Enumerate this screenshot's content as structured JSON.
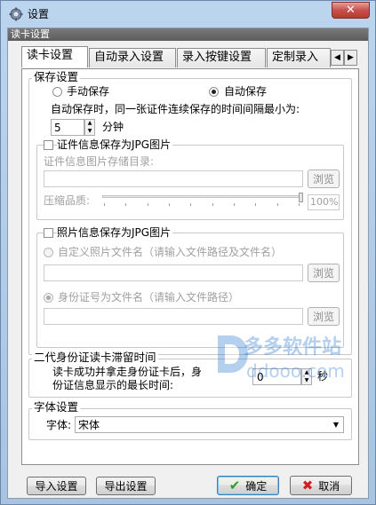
{
  "window": {
    "title": "设置"
  },
  "section": {
    "label": "读卡设置"
  },
  "tabs": [
    "读卡设置",
    "自动录入设置",
    "录入按键设置",
    "定制录入"
  ],
  "save_group": {
    "title": "保存设置",
    "manual_label": "手动保存",
    "auto_label": "自动保存",
    "selected": "自动保存",
    "interval_label": "自动保存时，同一张证件连续保存的时间间隔最小为:",
    "interval_value": "5",
    "interval_unit": "分钟"
  },
  "cert_jpg": {
    "checkbox_label": "证件信息保存为JPG图片",
    "dir_label": "证件信息图片存储目录:",
    "dir_value": "",
    "browse": "浏览",
    "quality_label": "压缩品质:",
    "quality_value": "100%",
    "quality_level": 1.0
  },
  "photo_jpg": {
    "checkbox_label": "照片信息保存为JPG图片",
    "custom_name_label": "自定义照片文件名（请输入文件路径及文件名）",
    "custom_value": "",
    "browse1": "浏览",
    "id_name_label": "身份证号为文件名（请输入文件路径）",
    "id_value": "",
    "browse2": "浏览"
  },
  "stay_group": {
    "title": "二代身份证读卡滞留时间",
    "label_line1": "读卡成功并拿走身份证卡后，身",
    "label_line2": "份证信息显示的最长时间:",
    "value": "0",
    "unit": "秒"
  },
  "font_group": {
    "title": "字体设置",
    "font_label": "字体:",
    "font_value": "宋体"
  },
  "buttons": {
    "import": "导入设置",
    "export": "导出设置",
    "ok": "确定",
    "cancel": "取消"
  },
  "watermark": {
    "cn": "多多软件站",
    "url": "ddooo.com"
  },
  "colors": {
    "close_button": "#c75050",
    "ok_check": "#2e9b2e",
    "cancel_x": "#d02020"
  }
}
